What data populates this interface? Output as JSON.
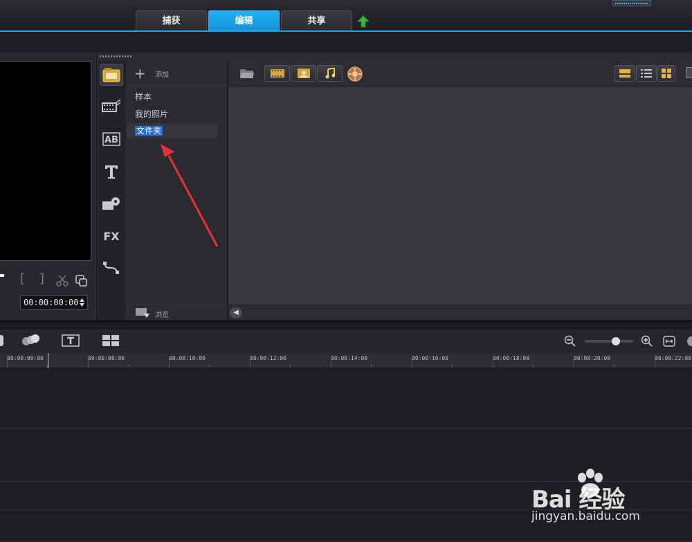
{
  "tabs": [
    {
      "label": "捕获",
      "active": false
    },
    {
      "label": "编辑",
      "active": true
    },
    {
      "label": "共享",
      "active": false
    }
  ],
  "preview": {
    "timecode": "00:00:00:00"
  },
  "library": {
    "add_label": "添加",
    "browse_label": "浏览",
    "folders": [
      "样本",
      "我的照片",
      "文件夹"
    ],
    "selected_folder": "文件夹",
    "side_icons": [
      "media-icon",
      "transition-icon",
      "title-ab-icon",
      "text-t-icon",
      "graphics-icon",
      "fx-icon",
      "path-icon"
    ],
    "fx_label": "FX"
  },
  "timeline": {
    "ruler_labels": [
      "00:00:06:00",
      "00:00:08:00",
      "00:00:10:00",
      "00:00:12:00",
      "00:00:14:00",
      "00:00:16:00",
      "00:00:18:00",
      "00:00:20:00",
      "00:00:22:00"
    ]
  },
  "watermark": {
    "logo_text": "Bai 经验",
    "url": "jingyan.baidu.com"
  },
  "colors": {
    "accent": "#1aa3e8",
    "selection": "#1f6ed4",
    "annotation_arrow": "#e8303a"
  }
}
